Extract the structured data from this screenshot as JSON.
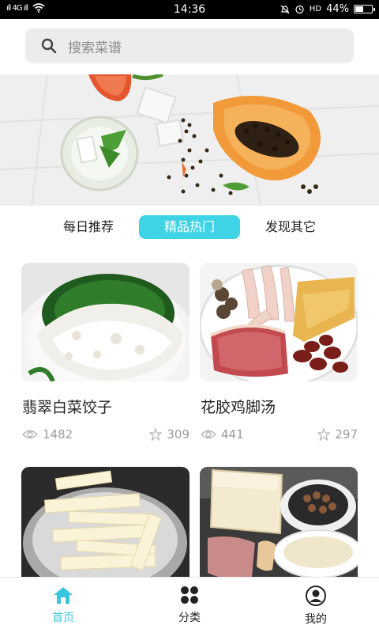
{
  "status_bar": {
    "signal": "ıll 4G ıll",
    "time": "14:36",
    "volte": "HD",
    "battery": "44%"
  },
  "search": {
    "placeholder": "搜索菜谱"
  },
  "tabs": [
    {
      "label": "每日推荐"
    },
    {
      "label": "精品热门"
    },
    {
      "label": "发现其它"
    }
  ],
  "recipes": [
    {
      "title": "翡翠白菜饺子",
      "views": "1482",
      "likes": "309"
    },
    {
      "title": "花胶鸡脚汤",
      "views": "441",
      "likes": "297"
    }
  ],
  "bottom_nav": [
    {
      "label": "首页"
    },
    {
      "label": "分类"
    },
    {
      "label": "我的"
    }
  ],
  "colors": {
    "accent": "#3fd3e6",
    "nav_active": "#38c6dc"
  }
}
